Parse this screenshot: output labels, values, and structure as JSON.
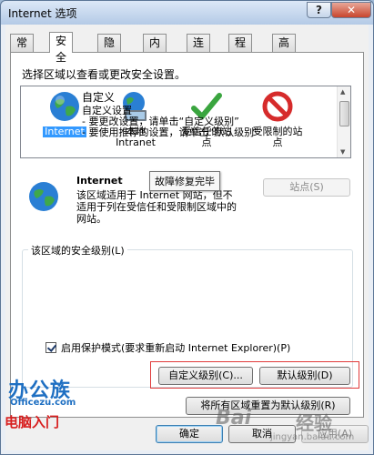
{
  "window": {
    "title": "Internet 选项",
    "help_label": "?",
    "close_label": "✕"
  },
  "tabs": [
    {
      "label": "常规"
    },
    {
      "label": "安全"
    },
    {
      "label": "隐私"
    },
    {
      "label": "内容"
    },
    {
      "label": "连接"
    },
    {
      "label": "程序"
    },
    {
      "label": "高级"
    }
  ],
  "active_tab": "安全",
  "zones": {
    "prompt": "选择区域以查看或更改安全设置。",
    "items": [
      {
        "label": "Internet",
        "icon": "globe-icon",
        "selected": true
      },
      {
        "label": "本地\nIntranet",
        "icon": "intranet-globe-icon",
        "selected": false
      },
      {
        "label": "受信任的站\n点",
        "icon": "check-icon",
        "selected": false
      },
      {
        "label": "受限制的站\n点",
        "icon": "no-entry-icon",
        "selected": false
      }
    ]
  },
  "tooltip": "故障修复完毕",
  "detail": {
    "title": "Internet",
    "description": "该区域适用于 Internet 网站，但不适用于列在受信任和受限制区域中的网站。",
    "sites_button": "站点(S)"
  },
  "security_level": {
    "group_title": "该区域的安全级别(L)",
    "level_name": "自定义",
    "level_description": "自定义设置\n - 要更改设置，请单击“自定义级别”\n - 要使用推荐的设置，请单击“默认级别”"
  },
  "protected_mode": {
    "label": "启用保护模式(要求重新启动 Internet Explorer)(P)",
    "checked": true
  },
  "buttons": {
    "custom_level": "自定义级别(C)...",
    "default_level": "默认级别(D)",
    "reset_all": "将所有区域重置为默认级别(R)",
    "ok": "确定",
    "cancel": "取消",
    "apply": "应用(A)"
  },
  "watermarks": {
    "left_logo": "办公族",
    "left_site": "Officezu.com",
    "left_sub": "电脑入门",
    "right_baidu": "Bai",
    "right_jingyan": "经验",
    "right_url": "jingyan.baidu.com"
  },
  "colors": {
    "selection": "#3399ff",
    "highlight_box": "#e03a3a",
    "close_button": "#c8452d"
  }
}
